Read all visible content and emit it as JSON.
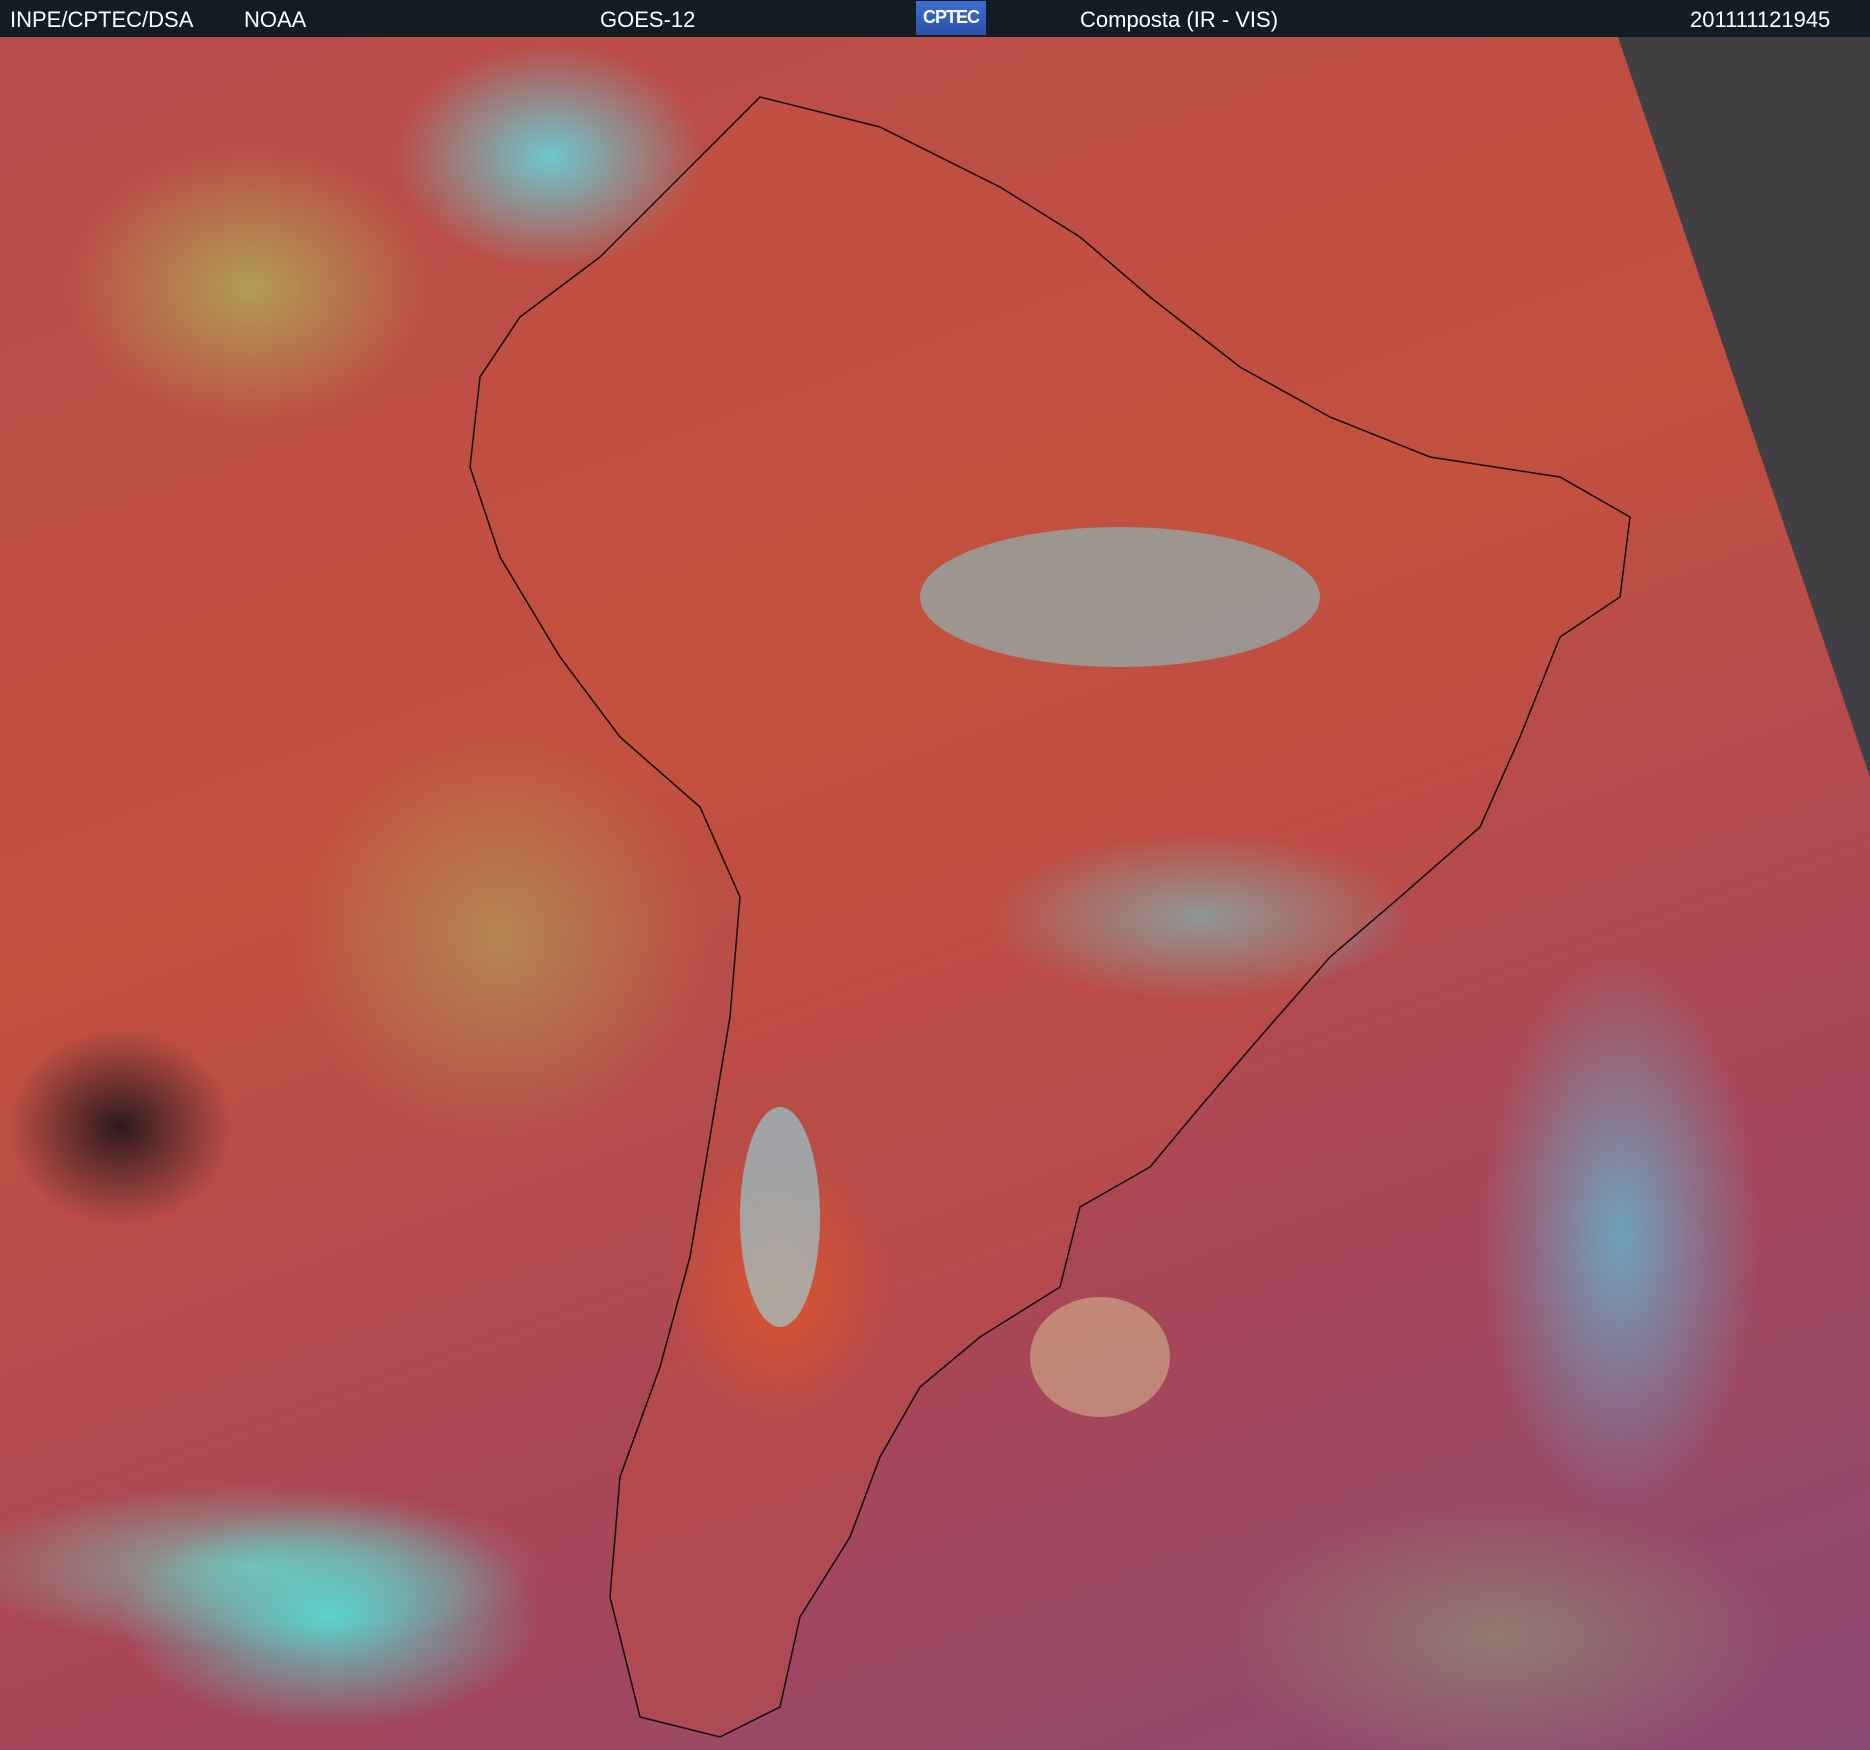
{
  "header": {
    "agency": "INPE/CPTEC/DSA",
    "source": "NOAA",
    "satellite": "GOES-12",
    "logo_text": "CPTEC",
    "product": "Composta (IR - VIS)",
    "timestamp": "201111121945"
  },
  "colors": {
    "header_bg": "#111c24",
    "ocean": "#b84c4c",
    "cloud_cyan": "#5ae6f0",
    "land_orange": "#e0582c"
  }
}
